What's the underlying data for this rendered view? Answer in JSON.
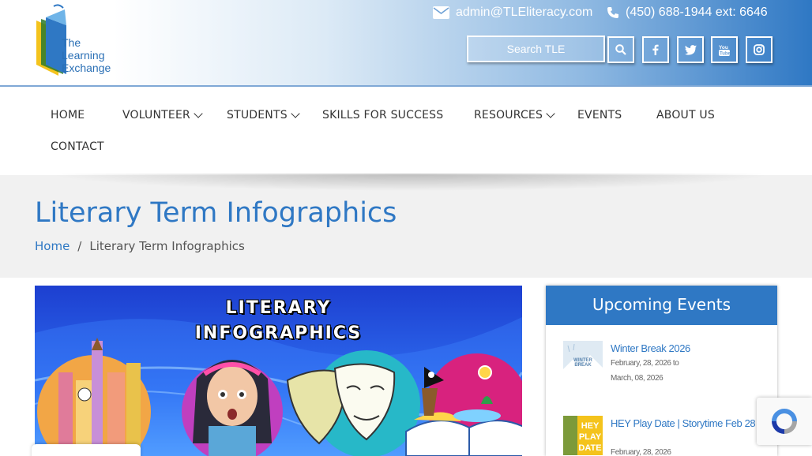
{
  "header": {
    "logo": {
      "line1": "The",
      "line2": "Learning",
      "line3": "Exchange"
    },
    "email": "admin@TLEliteracy.com",
    "phone": "(450) 688-1944 ext: 6646",
    "search_placeholder": "Search TLE",
    "social": [
      "search-icon",
      "facebook-icon",
      "twitter-icon",
      "youtube-icon",
      "instagram-icon"
    ]
  },
  "nav": {
    "items": [
      {
        "label": "HOME",
        "dropdown": false
      },
      {
        "label": "VOLUNTEER",
        "dropdown": true
      },
      {
        "label": "STUDENTS",
        "dropdown": true
      },
      {
        "label": "SKILLS FOR SUCCESS",
        "dropdown": false
      },
      {
        "label": "RESOURCES",
        "dropdown": true
      },
      {
        "label": "EVENTS",
        "dropdown": false
      },
      {
        "label": "ABOUT US",
        "dropdown": false
      },
      {
        "label": "CONTACT",
        "dropdown": false
      }
    ]
  },
  "page": {
    "title": "Literary Term Infographics",
    "breadcrumb": {
      "home": "Home",
      "separator": "/",
      "current": "Literary Term Infographics"
    }
  },
  "hero": {
    "line1": "LITERARY",
    "line2": "INFOGRAPHICS"
  },
  "sidebar": {
    "heading": "Upcoming Events",
    "events": [
      {
        "title": "Winter Break 2026",
        "date_line1": "February, 28, 2026 to",
        "date_line2": "March, 08, 2026",
        "thumb_text": "WINTER BREAK"
      },
      {
        "title": "HEY Play Date | Storytime Feb 28",
        "date_line1": "February, 28, 2026",
        "thumb_text": "HEY PLAY DATE"
      }
    ]
  },
  "colors": {
    "brand": "#2f78c4",
    "band": "#f1f1f1"
  }
}
